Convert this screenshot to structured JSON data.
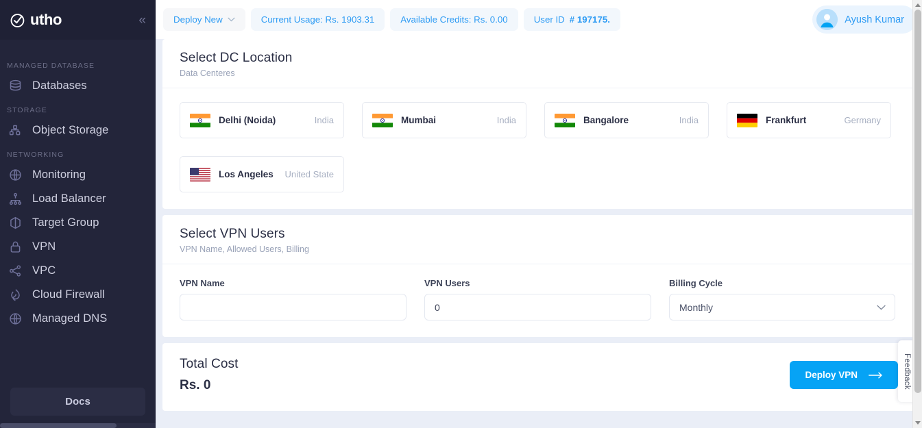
{
  "sidebar": {
    "logo_text": "utho",
    "collapse_icon": "chevron-double-left-icon",
    "groups": [
      {
        "label": "MANAGED DATABASE",
        "items": [
          {
            "label": "Databases",
            "icon": "database-icon"
          }
        ]
      },
      {
        "label": "STORAGE",
        "items": [
          {
            "label": "Object Storage",
            "icon": "object-storage-icon"
          }
        ]
      },
      {
        "label": "NETWORKING",
        "items": [
          {
            "label": "Monitoring",
            "icon": "globe-icon"
          },
          {
            "label": "Load Balancer",
            "icon": "hierarchy-icon"
          },
          {
            "label": "Target Group",
            "icon": "cube-icon"
          },
          {
            "label": "VPN",
            "icon": "lock-icon"
          },
          {
            "label": "VPC",
            "icon": "share-nodes-icon"
          },
          {
            "label": "Cloud Firewall",
            "icon": "flame-icon"
          },
          {
            "label": "Managed DNS",
            "icon": "globe-icon"
          }
        ]
      }
    ],
    "docs_label": "Docs"
  },
  "topbar": {
    "deploy_new": "Deploy New",
    "deploy_caret_icon": "chevron-down-icon",
    "current_usage": "Current Usage: Rs. 1903.31",
    "available_credits": "Available Credits: Rs. 0.00",
    "user_id_prefix": "User ID ",
    "user_id_value": "# 197175.",
    "user_name": "Ayush Kumar",
    "avatar_icon": "user-avatar-icon"
  },
  "dc_section": {
    "title": "Select DC Location",
    "subtitle": "Data Centeres",
    "locations": [
      {
        "city": "Delhi (Noida)",
        "country": "India",
        "flag": "flag-india"
      },
      {
        "city": "Mumbai",
        "country": "India",
        "flag": "flag-india"
      },
      {
        "city": "Bangalore",
        "country": "India",
        "flag": "flag-india"
      },
      {
        "city": "Frankfurt",
        "country": "Germany",
        "flag": "flag-germany"
      },
      {
        "city": "Los Angeles",
        "country": "United State",
        "flag": "flag-usa"
      }
    ]
  },
  "vpn_section": {
    "title": "Select VPN Users",
    "subtitle": "VPN Name, Allowed Users, Billing",
    "vpn_name_label": "VPN Name",
    "vpn_name_value": "",
    "vpn_name_placeholder": "",
    "vpn_users_label": "VPN Users",
    "vpn_users_value": "0",
    "billing_label": "Billing Cycle",
    "billing_value": "Monthly",
    "billing_caret_icon": "chevron-down-icon",
    "billing_options": [
      "Monthly"
    ]
  },
  "cost_section": {
    "title": "Total Cost",
    "value": "Rs. 0",
    "deploy_button": "Deploy VPN",
    "deploy_arrow_icon": "arrow-right-icon"
  },
  "feedback": {
    "label": "Feedback"
  },
  "colors": {
    "sidebar_bg": "#23253a",
    "accent_blue": "#06a3f5",
    "pill_blue": "#2f9cf4",
    "content_bg": "#eaeef7"
  }
}
